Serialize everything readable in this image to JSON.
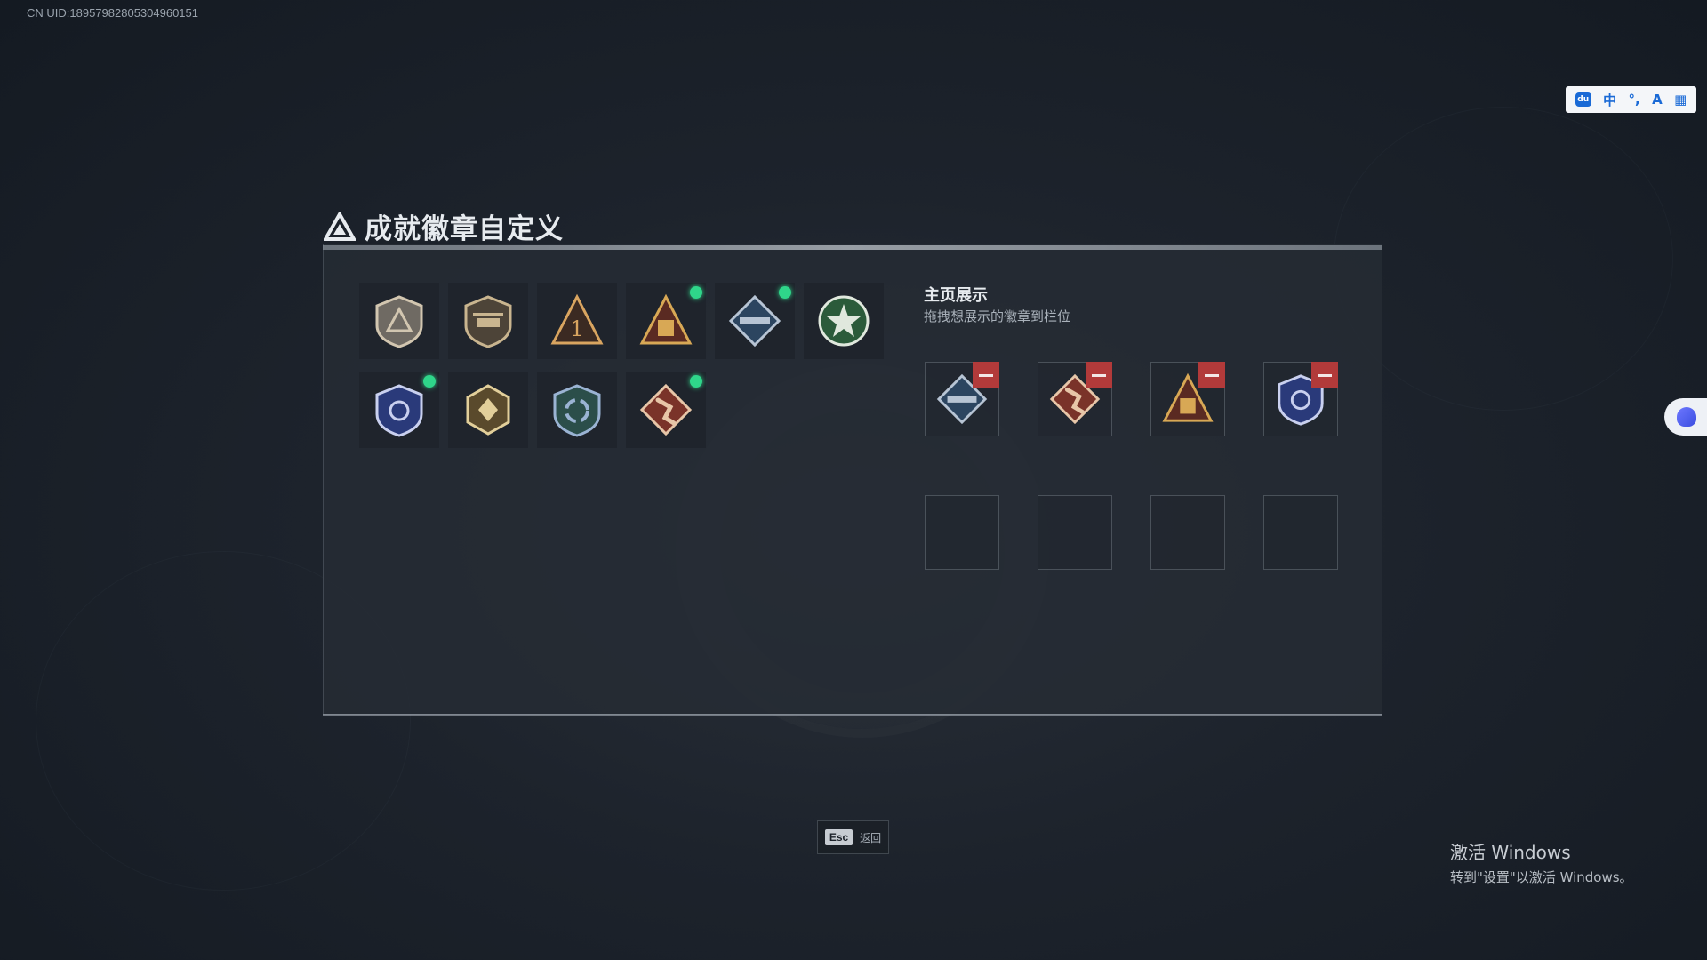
{
  "uid_text": "CN UID:18957982805304960151",
  "ime": {
    "paw_icon": "baidu-paw-icon",
    "lang": "中",
    "punct": "°,",
    "skin": "A",
    "grid": "▦"
  },
  "title": "成就徽章自定义",
  "badges": [
    {
      "name": "badge-triangle-shield",
      "new": false,
      "colors": [
        "#6f6a63",
        "#d2c6b0"
      ]
    },
    {
      "name": "badge-helicopter",
      "new": false,
      "colors": [
        "#4d4438",
        "#c9b58f"
      ]
    },
    {
      "name": "badge-rank-one",
      "new": false,
      "colors": [
        "#3b2a22",
        "#d9a560"
      ]
    },
    {
      "name": "badge-supply-crate",
      "new": true,
      "colors": [
        "#5a2a22",
        "#d8a855"
      ]
    },
    {
      "name": "badge-rocket-launcher",
      "new": true,
      "colors": [
        "#2c4560",
        "#b7c4d4"
      ]
    },
    {
      "name": "badge-green-star",
      "new": false,
      "colors": [
        "#2b5b3a",
        "#e0e8dd"
      ]
    },
    {
      "name": "badge-blue-shield-emblem",
      "new": true,
      "colors": [
        "#2a3a7a",
        "#c9d0ef"
      ]
    },
    {
      "name": "badge-gold-hexagon",
      "new": false,
      "colors": [
        "#5a4a2c",
        "#e2cf9a"
      ]
    },
    {
      "name": "badge-recycle-shield",
      "new": false,
      "colors": [
        "#2b4e4a",
        "#9ab3d3"
      ]
    },
    {
      "name": "badge-runner",
      "new": true,
      "colors": [
        "#7a3329",
        "#e7c6a8"
      ]
    }
  ],
  "showcase": {
    "title": "主页展示",
    "subtitle": "拖拽想展示的徽章到栏位",
    "slots": [
      {
        "badge": "badge-rocket-launcher",
        "filled": true
      },
      {
        "badge": "badge-runner",
        "filled": true
      },
      {
        "badge": "badge-supply-crate",
        "filled": true
      },
      {
        "badge": "badge-blue-shield-emblem",
        "filled": true
      },
      {
        "badge": "",
        "filled": false
      },
      {
        "badge": "",
        "filled": false
      },
      {
        "badge": "",
        "filled": false
      },
      {
        "badge": "",
        "filled": false
      }
    ]
  },
  "esc": {
    "key": "Esc",
    "label": "返回"
  },
  "activation": {
    "line1": "激活 Windows",
    "line2": "转到\"设置\"以激活 Windows。"
  },
  "colors": {
    "new_indicator": "#2fd68a",
    "remove": "#b23a3a"
  }
}
